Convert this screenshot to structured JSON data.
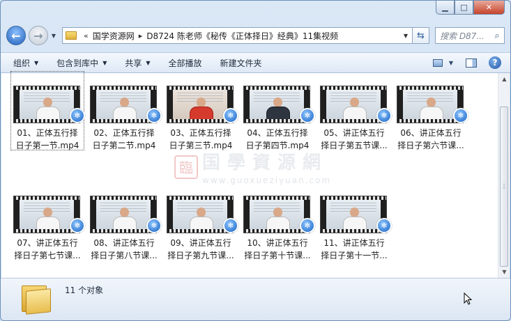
{
  "window": {
    "caption": {
      "minimize_glyph": "▁",
      "maximize_glyph": "□",
      "close_glyph": "✕"
    }
  },
  "nav": {
    "back_glyph": "←",
    "forward_glyph": "→",
    "dropdown_glyph": "▼",
    "breadcrumb_prefix": "«",
    "breadcrumbs": [
      "国学资源网",
      "D8724 陈老师《秘传《正体择日》经典》11集视频"
    ],
    "separator_glyph": "▸",
    "refresh_glyph": "⇆",
    "search_placeholder": "搜索 D87...",
    "search_glyph": "⌕"
  },
  "toolbar": {
    "items": [
      {
        "label": "组织",
        "dropdown": true
      },
      {
        "label": "包含到库中",
        "dropdown": true
      },
      {
        "label": "共享",
        "dropdown": true
      },
      {
        "label": "全部播放",
        "dropdown": false
      },
      {
        "label": "新建文件夹",
        "dropdown": false
      }
    ],
    "arrow_glyph": "▼",
    "help_glyph": "?"
  },
  "files": [
    {
      "line1": "01、正体五行择",
      "line2": "日子第一节.mp4",
      "shirt": "white"
    },
    {
      "line1": "02、正体五行择",
      "line2": "日子第二节.mp4",
      "shirt": "white"
    },
    {
      "line1": "03、正体五行择",
      "line2": "日子第三节.mp4",
      "shirt": "red"
    },
    {
      "line1": "04、正体五行择",
      "line2": "日子第四节.mp4",
      "shirt": "dark"
    },
    {
      "line1": "05、讲正体五行",
      "line2": "择日子第五节课...",
      "shirt": "white"
    },
    {
      "line1": "06、讲正体五行",
      "line2": "择日子第六节课...",
      "shirt": "white"
    },
    {
      "line1": "07、讲正体五行",
      "line2": "择日子第七节课...",
      "shirt": "white"
    },
    {
      "line1": "08、讲正体五行",
      "line2": "择日子第八节课...",
      "shirt": "white"
    },
    {
      "line1": "09、讲正体五行",
      "line2": "择日子第九节课...",
      "shirt": "white"
    },
    {
      "line1": "10、讲正体五行",
      "line2": "择日子第十节课...",
      "shirt": "white"
    },
    {
      "line1": "11、讲正体五行",
      "line2": "择日子第十一节...",
      "shirt": "white"
    }
  ],
  "media_badge_glyph": "✻",
  "watermark": {
    "seal": "臨",
    "cn": "国學資源網",
    "url": "www.guoxueziyuan.com"
  },
  "status": {
    "count_text": "11 个对象"
  },
  "colors": {
    "accent": "#1762c4",
    "window_frame": "#6b8fb8",
    "close_red": "#c6442b"
  }
}
